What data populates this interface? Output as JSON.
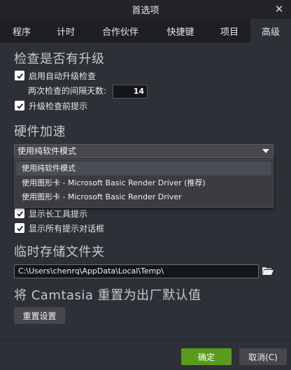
{
  "window": {
    "title": "首选项",
    "close_glyph": "✕"
  },
  "tabs": [
    {
      "label": "程序"
    },
    {
      "label": "计时"
    },
    {
      "label": "合作伙伴"
    },
    {
      "label": "快捷键"
    },
    {
      "label": "项目"
    },
    {
      "label": "高级",
      "active": true
    }
  ],
  "updates": {
    "title": "检查是否有升级",
    "enable_auto_check": {
      "label": "启用自动升级检查",
      "checked": true
    },
    "interval_label": "两次检查的间隔天数:",
    "interval_days": "14",
    "prompt_before_upgrade": {
      "label": "升级检查前提示",
      "checked": true
    }
  },
  "hardware": {
    "title": "硬件加速",
    "selected": "使用纯软件模式",
    "options": [
      "使用纯软件模式",
      "使用图形卡 - Microsoft Basic Render Driver (推荐)",
      "使用图形卡 - Microsoft Basic Render Driver"
    ]
  },
  "hints": {
    "show_long_toolbar_hints": {
      "label": "显示长工具提示",
      "checked": true
    },
    "show_all_hint_dialogs": {
      "label": "显示所有提示对话框",
      "checked": true
    }
  },
  "temp_folder": {
    "title": "临时存储文件夹",
    "path": "C:\\Users\\chenrq\\AppData\\Local\\Temp\\"
  },
  "reset": {
    "title": "将 Camtasia 重置为出厂默认值",
    "button_label": "重置设置"
  },
  "footer": {
    "ok_label": "确定",
    "cancel_label": "取消(C)"
  },
  "colors": {
    "background": "#2e3037",
    "ok_button": "#5a9b1d",
    "tab_bar": "#1e1f23"
  }
}
